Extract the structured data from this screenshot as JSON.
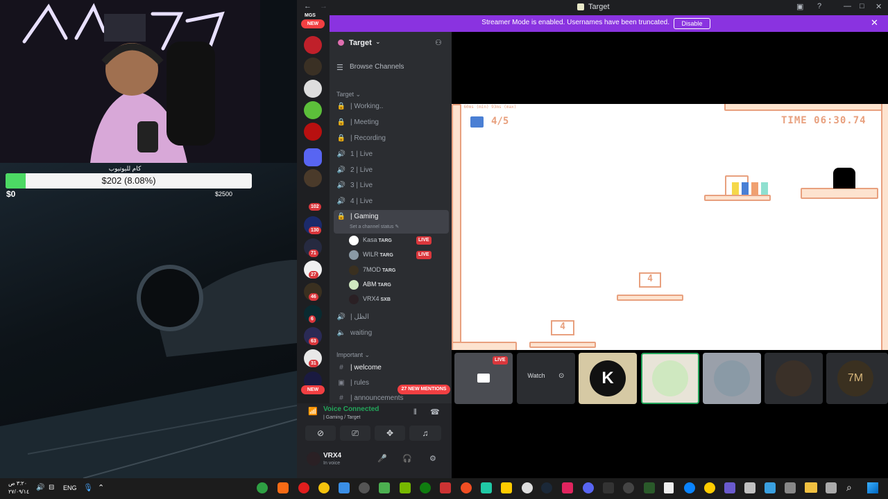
{
  "overlay": {
    "goal_title": "كام لليوتيوب",
    "goal_text": "$202 (8.08%)",
    "goal_fraction": 0.0808,
    "goal_min": "$0",
    "goal_max": "$2500"
  },
  "window": {
    "title": "Target"
  },
  "banner": {
    "text": "Streamer Mode is enabled. Usernames have been truncated.",
    "button": "Disable"
  },
  "servers": {
    "top_label": "MGS",
    "new_top": "NEW",
    "new_bottom": "NEW",
    "badges": [
      "102",
      "130",
      "71",
      "27",
      "46",
      "6",
      "63",
      "31"
    ]
  },
  "channels": {
    "server_name": "Target",
    "browse": "Browse Channels",
    "category_target": "Target",
    "category_important": "Important",
    "items": [
      {
        "name": "| Working..",
        "icon": "lock"
      },
      {
        "name": "| Meeting",
        "icon": "lock"
      },
      {
        "name": "| Recording",
        "icon": "lock"
      },
      {
        "name": "1 | Live",
        "icon": "speaker"
      },
      {
        "name": "2 | Live",
        "icon": "speaker"
      },
      {
        "name": "3 | Live",
        "icon": "speaker"
      },
      {
        "name": "4 | Live",
        "icon": "speaker"
      }
    ],
    "active": {
      "name": "| Gaming",
      "status": "Set a channel status"
    },
    "members": [
      {
        "name": "Kasa",
        "tag": "TARG",
        "live": "LIVE"
      },
      {
        "name": "WILR",
        "tag": "TARG",
        "live": "LIVE"
      },
      {
        "name": "7MOD",
        "tag": "TARG",
        "live": ""
      },
      {
        "name": "ABM",
        "tag": "TARG",
        "live": ""
      },
      {
        "name": "VRX4",
        "tag": "SXB",
        "live": ""
      }
    ],
    "after": [
      {
        "name": "| الظل",
        "icon": "speaker"
      },
      {
        "name": "waiting",
        "icon": "speaker"
      }
    ],
    "important": [
      {
        "name": "| welcome"
      },
      {
        "name": "| rules"
      },
      {
        "name": "| announcements"
      }
    ],
    "mentions": "27 NEW MENTIONS"
  },
  "voice": {
    "title": "Voice Connected",
    "sub": "| Gaming / Target",
    "user": "VRX4",
    "user_status": "In voice"
  },
  "game": {
    "ping": "RTT 60ms (min) 93ms (max)",
    "hud_left": "4/5",
    "hud_right": "TIME 06:30.74",
    "sign1": "4",
    "sign2": "4"
  },
  "tiles": {
    "live": "LIVE",
    "watch": "Watch"
  },
  "taskbar": {
    "time": "٣:٢٠ ص",
    "date": "٢٧/٠٩/١٤",
    "lang": "ENG"
  },
  "colors": {
    "accent": "#8a33e0",
    "live": "#da373c",
    "online": "#23a55a",
    "game_orange": "#e8a07e"
  }
}
